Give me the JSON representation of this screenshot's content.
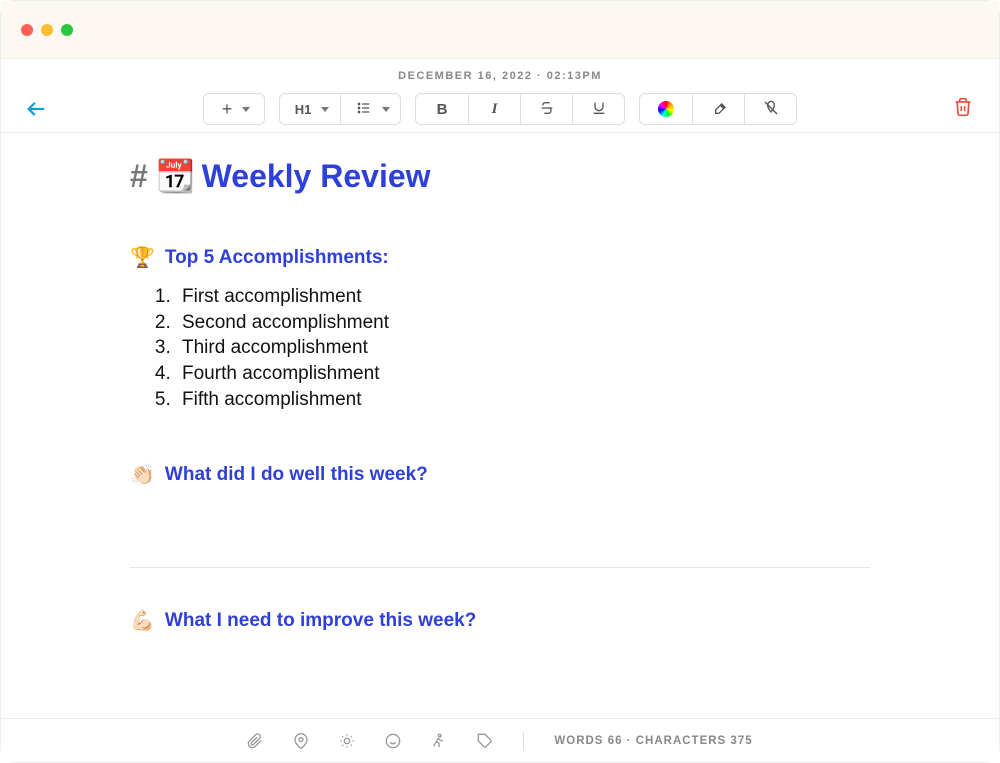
{
  "header": {
    "date_label": "DECEMBER 16, 2022 · 02:13PM"
  },
  "toolbar": {
    "heading_label": "H1"
  },
  "document": {
    "hash": "#",
    "title_emoji": "📆",
    "title_text": "Weekly Review",
    "sections": {
      "accomplishments": {
        "emoji": "🏆",
        "heading": "Top 5 Accomplishments:",
        "items": [
          "First accomplishment",
          "Second accomplishment",
          "Third accomplishment",
          "Fourth accomplishment",
          "Fifth accomplishment"
        ]
      },
      "did_well": {
        "emoji": "👏🏻",
        "heading": "What did I do well this week?"
      },
      "improve": {
        "emoji": "💪🏻",
        "heading": "What I need to improve this week?"
      }
    }
  },
  "status": {
    "words_label": "WORDS",
    "words_value": "66",
    "chars_label": "CHARACTERS",
    "chars_value": "375"
  }
}
